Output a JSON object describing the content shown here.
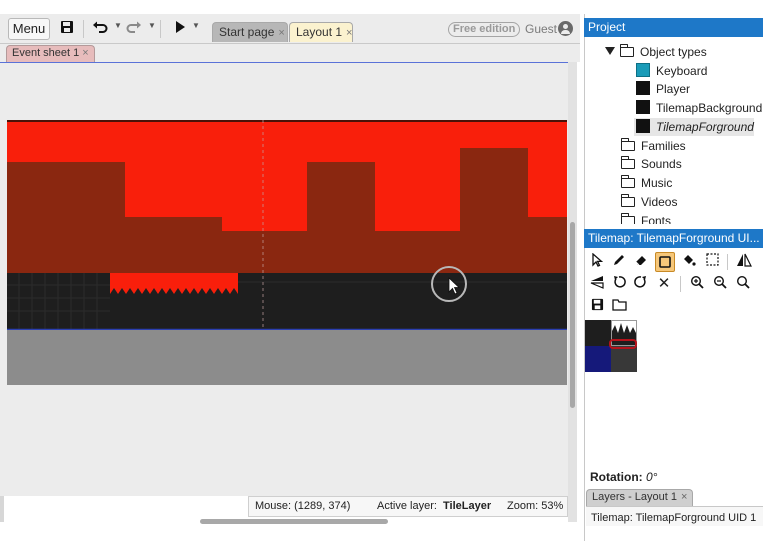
{
  "toolbar": {
    "menu_label": "Menu",
    "tabs": [
      {
        "label": "Start page",
        "close": "×"
      },
      {
        "label": "Layout 1",
        "close": "×"
      }
    ],
    "edition_badge": "Free edition",
    "user_label": "Guest"
  },
  "subtabs": [
    {
      "label": "Event sheet 1",
      "close": "×"
    }
  ],
  "statusbar": {
    "mouse": "Mouse: (1289, 374)",
    "active_layer_label": "Active layer:",
    "active_layer_value": "TileLayer",
    "zoom": "Zoom: 53%"
  },
  "project_panel": {
    "title": "Project",
    "object_types_label": "Object types",
    "objects": [
      {
        "label": "Keyboard",
        "icon": "keyboard-icon"
      },
      {
        "label": "Player",
        "icon": "player-icon"
      },
      {
        "label": "TilemapBackground",
        "icon": "tilemap-icon"
      },
      {
        "label": "TilemapForground",
        "icon": "tilemap-icon"
      }
    ],
    "folders": [
      "Families",
      "Sounds",
      "Music",
      "Videos",
      "Fonts"
    ]
  },
  "tilemap_panel": {
    "title": "Tilemap: TilemapForground UI...",
    "rotation_label": "Rotation:",
    "rotation_value": "0°",
    "tools_row1": [
      "pointer-icon",
      "pencil-icon",
      "eraser-icon",
      "rectangle-icon",
      "fill-icon",
      "selection-icon",
      "flip-horizontal-icon"
    ],
    "tools_row2": [
      "rotate-left-icon",
      "rotate-right-icon",
      "close-icon",
      "zoom-out-icon",
      "zoom-in-icon",
      "zoom-reset-icon"
    ],
    "tools_row3": [
      "save-icon",
      "folder-icon"
    ]
  },
  "layers_panel": {
    "tab_label": "Layers - Layout 1",
    "close": "×",
    "info": "Tilemap: TilemapForground UID 1"
  },
  "colors": {
    "accent": "#1e78c8",
    "sky_red": "#f91f0b",
    "wall_dark_red": "#8a2710",
    "ground_black": "#1e1e1e",
    "floor_grey": "#8c8c8c"
  }
}
